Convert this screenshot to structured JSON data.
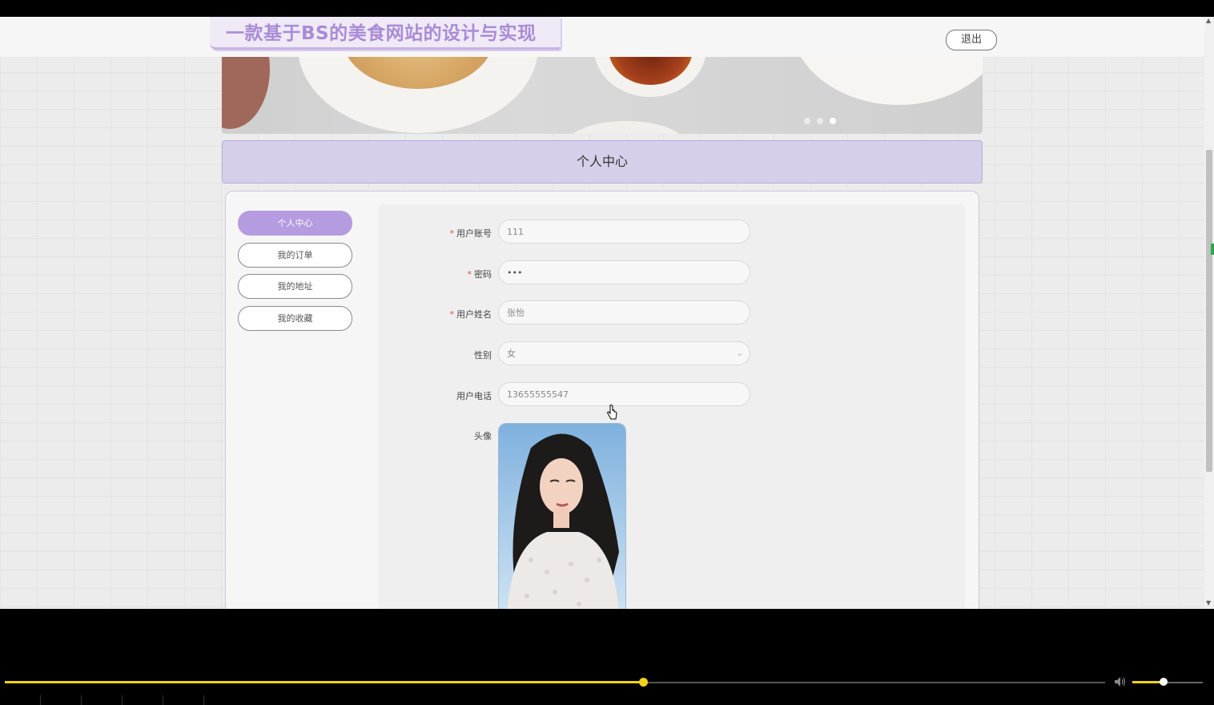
{
  "header": {
    "site_title": "一款基于BS的美食网站的设计与实现",
    "logout_label": "退出"
  },
  "banner": {
    "slide_count": 3,
    "active_slide": 3
  },
  "section": {
    "title": "个人中心"
  },
  "sidebar": {
    "items": [
      {
        "label": "个人中心",
        "active": true
      },
      {
        "label": "我的订单",
        "active": false
      },
      {
        "label": "我的地址",
        "active": false
      },
      {
        "label": "我的收藏",
        "active": false
      }
    ]
  },
  "form": {
    "account": {
      "label": "用户账号",
      "required": true,
      "value": "111"
    },
    "password": {
      "label": "密码",
      "required": true,
      "value": "•••"
    },
    "name": {
      "label": "用户姓名",
      "required": true,
      "value": "张怡"
    },
    "gender": {
      "label": "性别",
      "required": false,
      "value": "女"
    },
    "phone": {
      "label": "用户电话",
      "required": false,
      "value": "13655555547"
    },
    "avatar": {
      "label": "头像"
    }
  },
  "player": {
    "progress": 0.58,
    "volume": 0.44
  },
  "colors": {
    "accent": "#b59be0",
    "title": "#a98bd6",
    "section_bg": "#d6cfea",
    "progress": "#f2d21b"
  }
}
